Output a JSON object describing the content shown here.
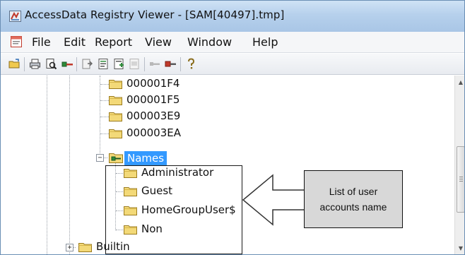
{
  "window": {
    "title": "AccessData Registry Viewer - [SAM[40497].tmp]"
  },
  "menubar": {
    "items": [
      "File",
      "Edit",
      "Report",
      "View",
      "Window",
      "Help"
    ]
  },
  "toolbar": {
    "buttons": [
      "open-icon",
      "print-icon",
      "print-preview-icon",
      "key-icon",
      "export-icon",
      "report-icon",
      "report-add-icon",
      "report-disabled-icon",
      "key-left-icon",
      "key-right-icon",
      "help-icon"
    ]
  },
  "tree": {
    "folders_above": [
      "000001F4",
      "000001F5",
      "000003E9",
      "000003EA"
    ],
    "names_node": "Names",
    "names_children": [
      "Administrator",
      "Guest",
      "HomeGroupUser$",
      "Non"
    ],
    "builtin_node": "Builtin",
    "expander_collapsed": "+",
    "expander_expanded": "−"
  },
  "annotation": {
    "line1": "List of user",
    "line2": "accounts name"
  },
  "colors": {
    "selection": "#3399ff",
    "folder": "#f3d978",
    "annotation_fill": "#d8d8d8"
  },
  "scrollbar": {
    "up_arrow": "▲",
    "down_arrow": "▼"
  }
}
